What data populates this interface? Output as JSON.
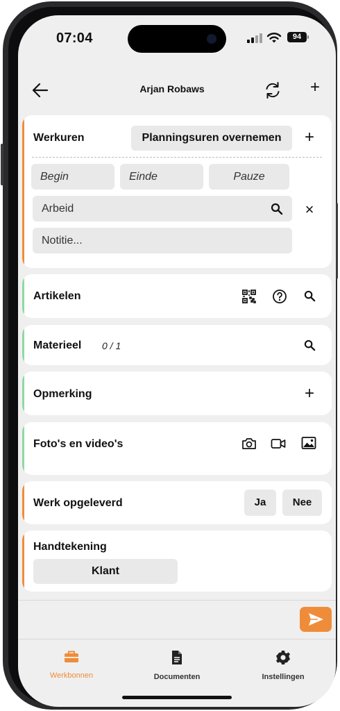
{
  "status_bar": {
    "time": "07:04",
    "battery": "94"
  },
  "header": {
    "title": "Arjan Robaws"
  },
  "werkuren": {
    "title": "Werkuren",
    "planning_button": "Planningsuren overnemen",
    "begin_placeholder": "Begin",
    "einde_placeholder": "Einde",
    "pauze_placeholder": "Pauze",
    "activity_value": "Arbeid",
    "note_placeholder": "Notitie..."
  },
  "artikelen": {
    "title": "Artikelen"
  },
  "materieel": {
    "title": "Materieel",
    "count": "0 / 1"
  },
  "opmerking": {
    "title": "Opmerking"
  },
  "fotos": {
    "title": "Foto's en video's"
  },
  "werk_opgeleverd": {
    "title": "Werk opgeleverd",
    "yes": "Ja",
    "no": "Nee"
  },
  "handtekening": {
    "title": "Handtekening",
    "klant_button": "Klant"
  },
  "tabs": [
    {
      "label": "Werkbonnen",
      "icon": "toolbox-icon",
      "active": true
    },
    {
      "label": "Documenten",
      "icon": "document-icon",
      "active": false
    },
    {
      "label": "Instellingen",
      "icon": "gear-icon",
      "active": false
    }
  ],
  "colors": {
    "accent_orange": "#ef8c3a",
    "accent_green": "#8ed9a0",
    "background": "#efefef",
    "pill": "#e9e9ea"
  }
}
